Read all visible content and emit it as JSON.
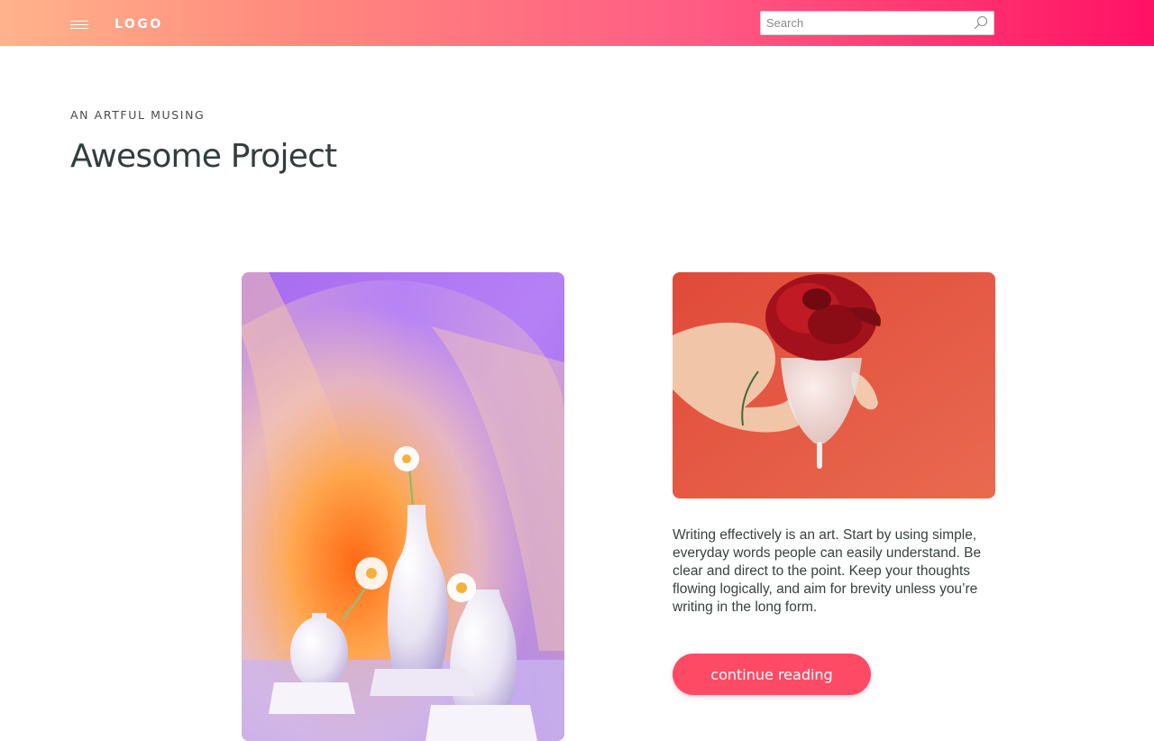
{
  "header": {
    "logo": "LOGO",
    "menu_icon": "hamburger-menu-icon",
    "search": {
      "placeholder": "Search",
      "value": "",
      "icon": "search-icon"
    }
  },
  "hero": {
    "eyebrow": "AN ARTFUL MUSING",
    "title": "Awesome Project"
  },
  "article": {
    "image_left": "vases-with-daisies-photo",
    "image_right": "rose-in-menstrual-cup-photo",
    "body": "Writing effectively is an art. Start by using simple, everyday words people can easily understand. Be clear and direct to the point. Keep your thoughts flowing logically, and aim for brevity unless you’re writing in the long form.",
    "cta_label": "continue reading"
  },
  "colors": {
    "header_gradient_start": "#ffb38c",
    "header_gradient_end": "#ff1166",
    "accent": "#ff4a65",
    "title_text": "#333d3d"
  }
}
